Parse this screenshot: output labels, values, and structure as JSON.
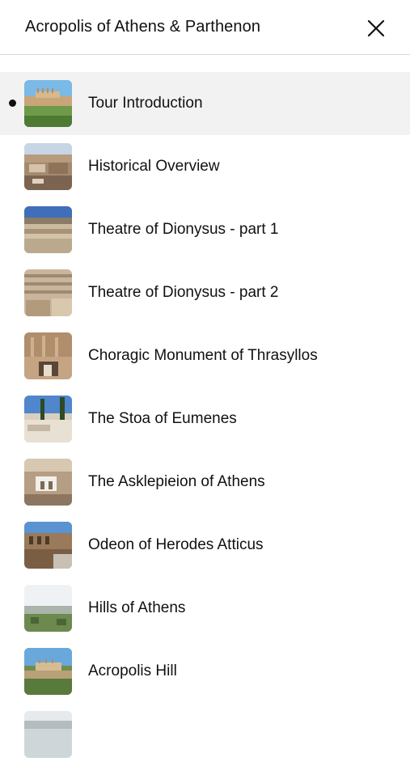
{
  "header": {
    "title": "Acropolis of Athens & Parthenon",
    "close_icon": "close-icon"
  },
  "items": [
    {
      "label": "Tour Introduction",
      "active": true,
      "thumb": "acropolis-sunset"
    },
    {
      "label": "Historical Overview",
      "active": false,
      "thumb": "ruins-stairs"
    },
    {
      "label": "Theatre of Dionysus - part 1",
      "active": false,
      "thumb": "theatre-wide"
    },
    {
      "label": "Theatre of Dionysus - part 2",
      "active": false,
      "thumb": "theatre-seats"
    },
    {
      "label": "Choragic Monument of Thrasyllos",
      "active": false,
      "thumb": "rock-cave"
    },
    {
      "label": "The Stoa of Eumenes",
      "active": false,
      "thumb": "stoa-cypress"
    },
    {
      "label": "The Asklepieion of Athens",
      "active": false,
      "thumb": "marble-shrine"
    },
    {
      "label": "Odeon of Herodes Atticus",
      "active": false,
      "thumb": "odeon-arches"
    },
    {
      "label": "Hills of Athens",
      "active": false,
      "thumb": "hills-view"
    },
    {
      "label": "Acropolis Hill",
      "active": false,
      "thumb": "acropolis-hill"
    },
    {
      "label": "",
      "active": false,
      "thumb": "city-view"
    }
  ],
  "colors": {
    "active_row": "#f2f2f2",
    "divider": "#d9d9d9",
    "text": "#111111"
  }
}
